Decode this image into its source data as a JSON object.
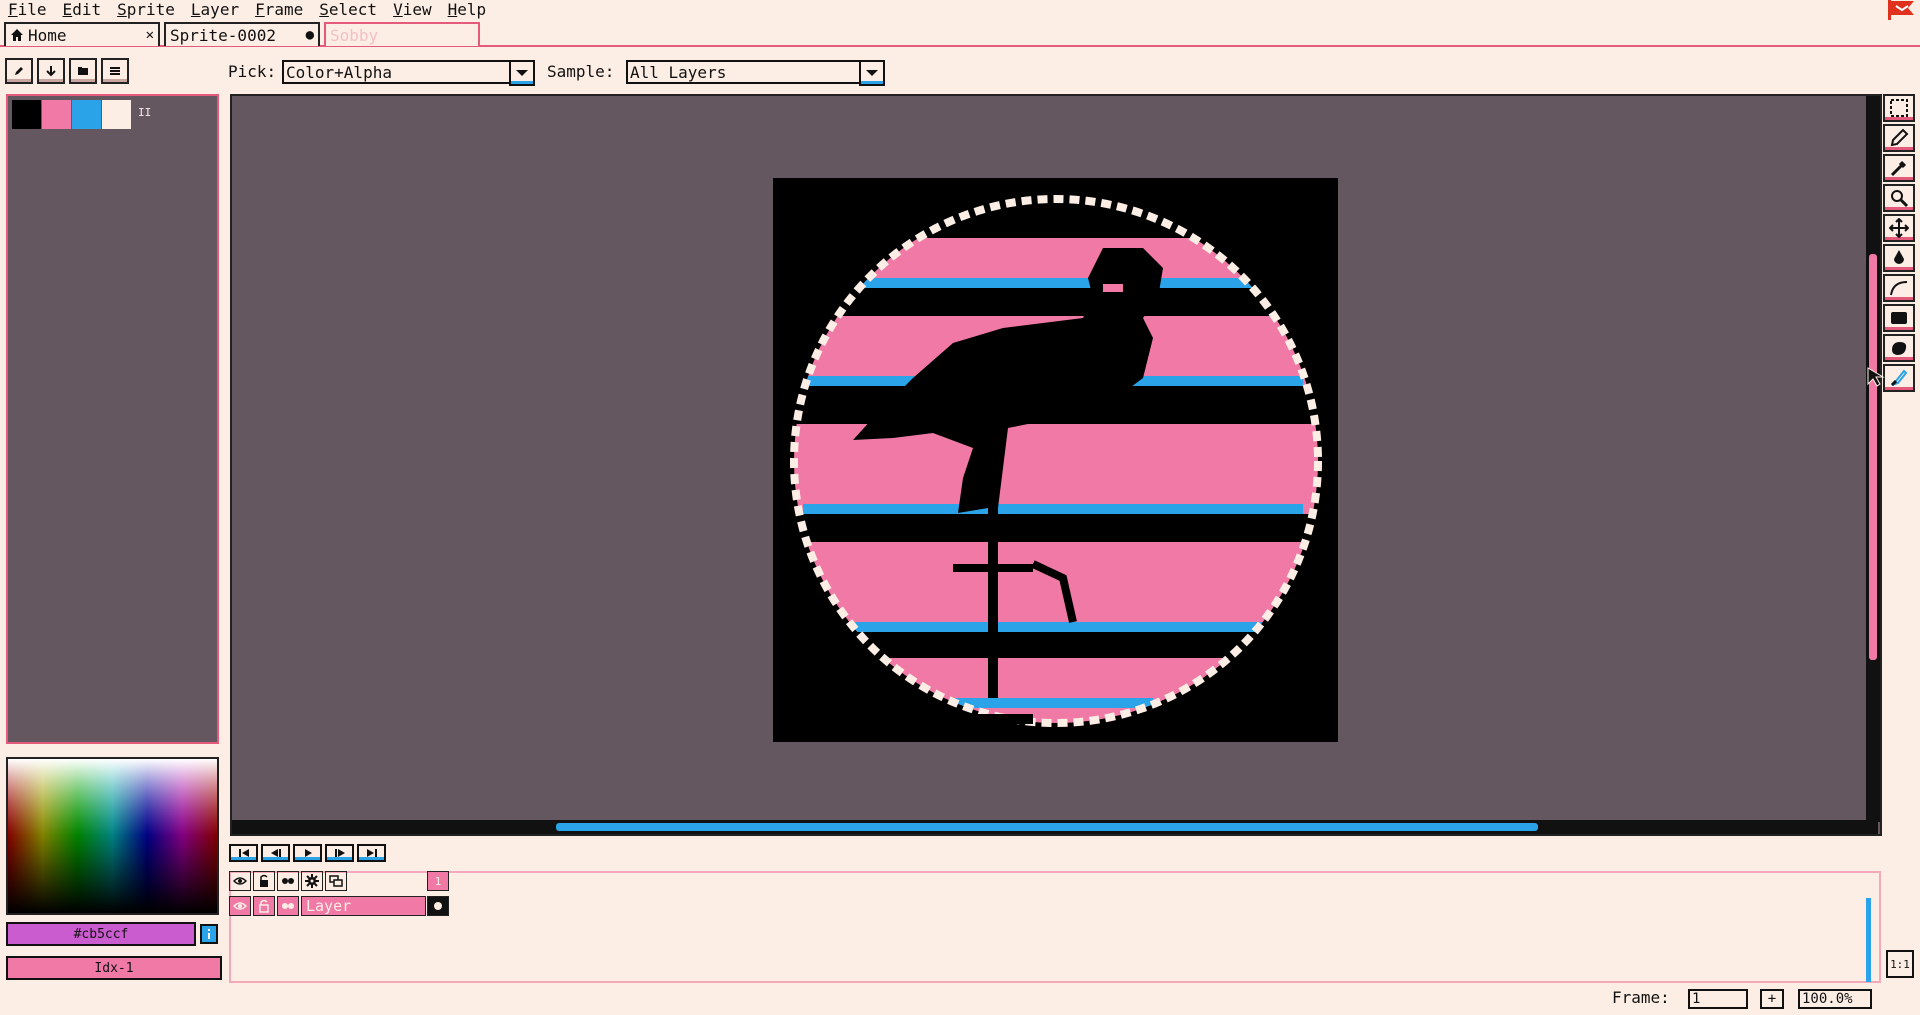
{
  "menu": [
    "File",
    "Edit",
    "Sprite",
    "Layer",
    "Frame",
    "Select",
    "View",
    "Help"
  ],
  "tabs": [
    {
      "label": "Home",
      "icon": "home-icon",
      "close": "✕"
    },
    {
      "label": "Sprite-0002",
      "icon": "",
      "close": "●"
    },
    {
      "label": "Sobby",
      "icon": "",
      "close": ""
    }
  ],
  "toolbar": {
    "pick_label": "Pick:",
    "pick_value": "Color+Alpha",
    "sample_label": "Sample:",
    "sample_value": "All Layers"
  },
  "palette": {
    "colors": [
      "#000000",
      "#f179a6",
      "#2aa3e8",
      "#fdeee5"
    ],
    "handle": "II"
  },
  "color_fields": {
    "hex": "#cb5ccf",
    "index": "Idx-1",
    "hex_color": "#cb5ccf",
    "index_color": "#f179a6"
  },
  "timeline": {
    "frame_number": "1",
    "layer_name": "Layer"
  },
  "status": {
    "frame_label": "Frame:",
    "frame_value": "1",
    "add_label": "+",
    "zoom": "100.0%",
    "ratio": "1:1"
  },
  "colors": {
    "accent_pink": "#e45a7a",
    "pink": "#f179a6",
    "blue": "#2aa3e8",
    "canvas_bg": "#645760",
    "cream": "#fdeee5"
  }
}
